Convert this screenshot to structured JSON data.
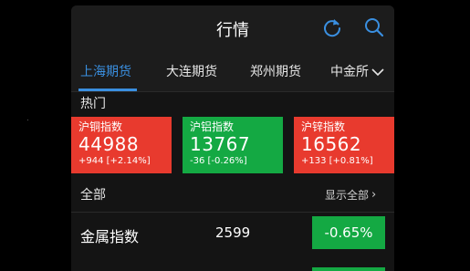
{
  "header": {
    "title": "行情"
  },
  "tabs": [
    {
      "label": "上海期货"
    },
    {
      "label": "大连期货"
    },
    {
      "label": "郑州期货"
    },
    {
      "label": "中金所"
    }
  ],
  "hot": {
    "title": "热门",
    "cards": [
      {
        "name": "沪铜指数",
        "value": "44988",
        "change": "+944 [+2.14%]",
        "trend": "up"
      },
      {
        "name": "沪铝指数",
        "value": "13767",
        "change": "-36 [-0.26%]",
        "trend": "down"
      },
      {
        "name": "沪锌指数",
        "value": "16562",
        "change": "+133 [+0.81%]",
        "trend": "up"
      }
    ]
  },
  "all": {
    "title": "全部",
    "show_all": "显示全部",
    "rows": [
      {
        "name": "金属指数",
        "price": "2599",
        "change": "-0.65%",
        "trend": "down"
      }
    ]
  },
  "colors": {
    "up": "#e83a2e",
    "down": "#14a943",
    "accent": "#3a8fe0"
  },
  "icons": {
    "refresh": "refresh-icon",
    "search": "search-icon",
    "more_tabs": "chevron-down-icon",
    "show_all": "chevron-right-icon"
  }
}
